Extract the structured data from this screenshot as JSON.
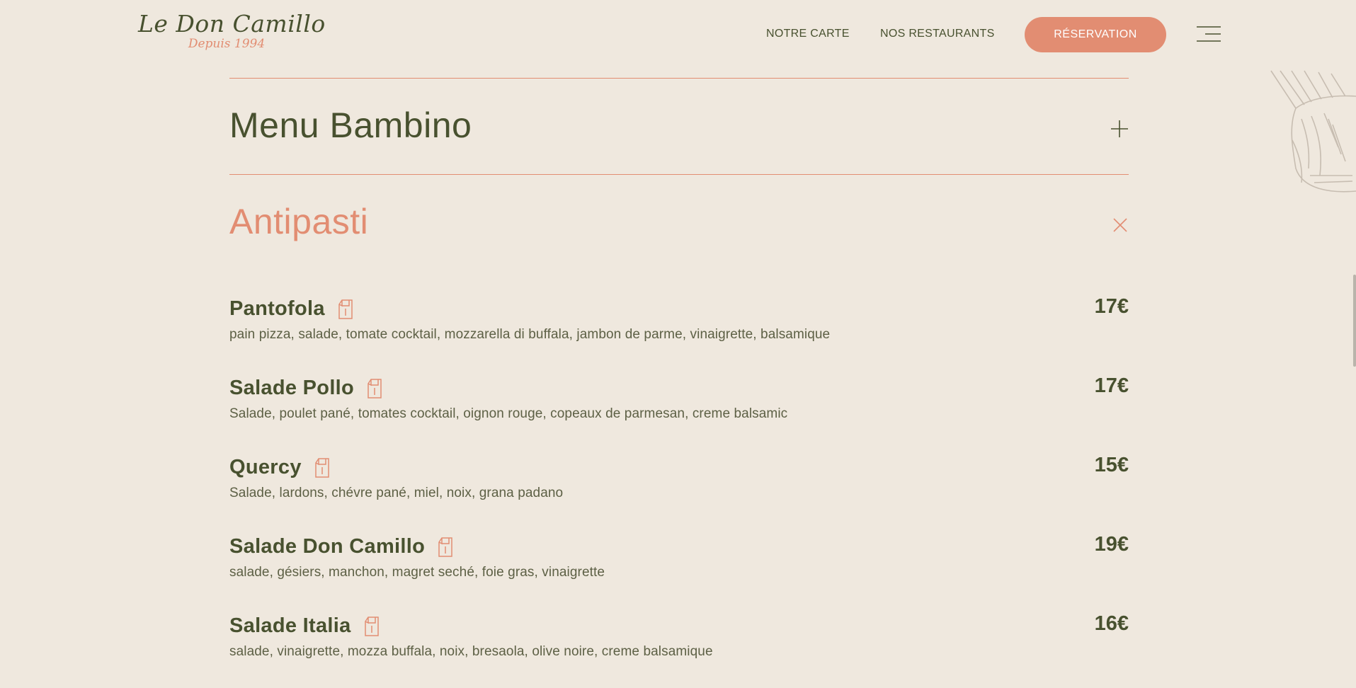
{
  "header": {
    "logo_title": "Le Don Camillo",
    "logo_subtitle": "Depuis 1994",
    "nav": {
      "carte": "NOTRE CARTE",
      "restaurants": "NOS RESTAURANTS"
    },
    "reservation_label": "RÉSERVATION",
    "menu_icon": "hamburger-icon"
  },
  "accordion": {
    "collapsed_section": {
      "title": "Menu Bambino",
      "icon": "plus-icon"
    },
    "open_section": {
      "title": "Antipasti",
      "icon": "close-icon",
      "items": [
        {
          "name": "Pantofola",
          "price": "17€",
          "description": "pain pizza, salade, tomate cocktail, mozzarella di buffala, jambon de parme, vinaigrette, balsamique",
          "icon": "takeaway-bag-icon"
        },
        {
          "name": "Salade Pollo",
          "price": "17€",
          "description": "Salade, poulet pané, tomates cocktail, oignon rouge, copeaux de parmesan, creme balsamic",
          "icon": "takeaway-bag-icon"
        },
        {
          "name": "Quercy",
          "price": "15€",
          "description": "Salade, lardons, chévre pané, miel, noix, grana padano",
          "icon": "takeaway-bag-icon"
        },
        {
          "name": "Salade Don Camillo",
          "price": "19€",
          "description": "salade, gésiers, manchon, magret seché, foie gras, vinaigrette",
          "icon": "takeaway-bag-icon"
        },
        {
          "name": "Salade Italia",
          "price": "16€",
          "description": "salade, vinaigrette, mozza buffala, noix, bresaola, olive noire, creme balsamique",
          "icon": "takeaway-bag-icon"
        }
      ]
    }
  },
  "colors": {
    "background": "#efe8de",
    "text_olive": "#48512f",
    "accent_coral": "#e28d72",
    "button_text": "#ffffff"
  }
}
